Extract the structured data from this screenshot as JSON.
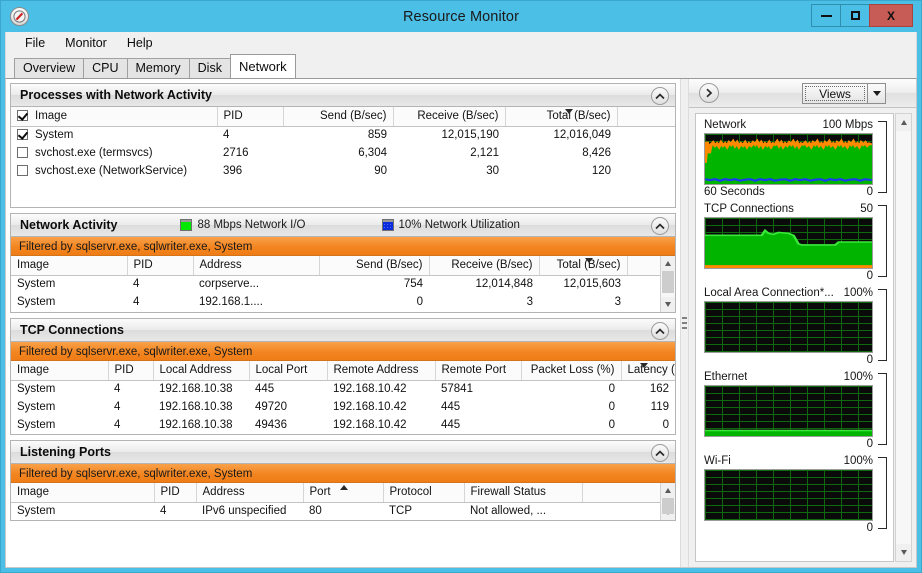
{
  "window": {
    "title": "Resource Monitor",
    "icon": "gauge-icon",
    "minimize_label": "–",
    "maximize_label": "□",
    "close_label": "X"
  },
  "menu": {
    "items": [
      "File",
      "Monitor",
      "Help"
    ]
  },
  "tabs": {
    "items": [
      "Overview",
      "CPU",
      "Memory",
      "Disk",
      "Network"
    ],
    "active": "Network"
  },
  "sections": {
    "processes": {
      "title": "Processes with Network Activity",
      "columns": [
        "Image",
        "PID",
        "Send (B/sec)",
        "Receive (B/sec)",
        "Total (B/sec)"
      ],
      "sort_column": "Total (B/sec)",
      "sort_dir": "desc",
      "rows": [
        {
          "checked": true,
          "image": "System",
          "pid": "4",
          "send": "859",
          "receive": "12,015,190",
          "total": "12,016,049"
        },
        {
          "checked": false,
          "image": "svchost.exe (termsvcs)",
          "pid": "2716",
          "send": "6,304",
          "receive": "2,121",
          "total": "8,426"
        },
        {
          "checked": false,
          "image": "svchost.exe (NetworkService)",
          "pid": "396",
          "send": "90",
          "receive": "30",
          "total": "120"
        }
      ]
    },
    "network_activity": {
      "title": "Network Activity",
      "legend": [
        {
          "color": "#00e800",
          "swatch": "green",
          "text": "88 Mbps Network I/O"
        },
        {
          "color": "#0a2bdb",
          "swatch": "blue",
          "text": "10% Network Utilization"
        }
      ],
      "filter": "Filtered by sqlservr.exe, sqlwriter.exe, System",
      "columns": [
        "Image",
        "PID",
        "Address",
        "Send (B/sec)",
        "Receive (B/sec)",
        "Total (B/sec)"
      ],
      "sort_column": "Total (B/sec)",
      "sort_dir": "desc",
      "rows": [
        {
          "image": "System",
          "pid": "4",
          "address": "corpserve...",
          "send": "754",
          "receive": "12,014,848",
          "total": "12,015,603"
        },
        {
          "image": "System",
          "pid": "4",
          "address": "192.168.1....",
          "send": "0",
          "receive": "3",
          "total": "3"
        }
      ]
    },
    "tcp_connections": {
      "title": "TCP Connections",
      "filter": "Filtered by sqlservr.exe, sqlwriter.exe, System",
      "columns": [
        "Image",
        "PID",
        "Local Address",
        "Local Port",
        "Remote Address",
        "Remote Port",
        "Packet Loss (%)",
        "Latency (ms)"
      ],
      "sort_column": "Latency (ms)",
      "sort_dir": "desc",
      "rows": [
        {
          "image": "System",
          "pid": "4",
          "local_address": "192.168.10.38",
          "local_port": "445",
          "remote_address": "192.168.10.42",
          "remote_port": "57841",
          "packet_loss": "0",
          "latency": "162"
        },
        {
          "image": "System",
          "pid": "4",
          "local_address": "192.168.10.38",
          "local_port": "49720",
          "remote_address": "192.168.10.42",
          "remote_port": "445",
          "packet_loss": "0",
          "latency": "119"
        },
        {
          "image": "System",
          "pid": "4",
          "local_address": "192.168.10.38",
          "local_port": "49436",
          "remote_address": "192.168.10.42",
          "remote_port": "445",
          "packet_loss": "0",
          "latency": "0"
        }
      ]
    },
    "listening_ports": {
      "title": "Listening Ports",
      "filter": "Filtered by sqlservr.exe, sqlwriter.exe, System",
      "columns": [
        "Image",
        "PID",
        "Address",
        "Port",
        "Protocol",
        "Firewall Status"
      ],
      "sort_column": "Port",
      "sort_dir": "asc",
      "rows": [
        {
          "image": "System",
          "pid": "4",
          "address": "IPv6 unspecified",
          "port": "80",
          "protocol": "TCP",
          "firewall": "Not allowed, ..."
        }
      ]
    }
  },
  "right_panel": {
    "expand_icon": "chevron-right-icon",
    "views_label": "Views",
    "views_dropdown_icon": "caret-down-icon",
    "graphs": [
      {
        "name": "Network",
        "scale_max": "100 Mbps",
        "scale_min": "0",
        "footer_left": "60 Seconds",
        "type": "network"
      },
      {
        "name": "TCP Connections",
        "scale_max": "50",
        "scale_min": "0",
        "footer_left": "",
        "type": "tcp"
      },
      {
        "name": "Local Area Connection*...",
        "scale_max": "100%",
        "scale_min": "0",
        "footer_left": "",
        "type": "empty"
      },
      {
        "name": "Ethernet",
        "scale_max": "100%",
        "scale_min": "0",
        "footer_left": "",
        "type": "ethernet"
      },
      {
        "name": "Wi-Fi",
        "scale_max": "100%",
        "scale_min": "0",
        "footer_left": "",
        "type": "empty"
      }
    ]
  },
  "chart_data": [
    {
      "type": "area",
      "title": "Network",
      "ylabel": "Mbps",
      "ylim": [
        0,
        100
      ],
      "xlabel": "60 Seconds",
      "grid": true,
      "series": [
        {
          "name": "Network I/O",
          "color": "#ff8a00",
          "values": [
            92,
            72,
            86,
            88,
            90,
            87,
            89,
            86,
            90,
            87,
            89,
            86,
            90,
            88,
            91,
            87,
            90,
            86,
            89,
            87,
            90,
            86,
            89,
            87,
            90,
            88,
            91,
            87,
            90,
            86,
            89,
            87,
            90,
            86,
            89,
            88,
            91,
            87,
            90,
            86,
            89,
            87,
            90,
            88,
            91,
            87,
            90,
            86,
            89,
            88
          ]
        },
        {
          "name": "Network Utilization",
          "color": "#1a3cf0",
          "values": [
            5,
            6,
            5,
            7,
            5,
            6,
            5,
            7,
            6,
            5,
            7,
            5,
            6,
            5,
            7,
            6,
            5,
            7,
            5,
            6,
            5,
            7,
            6,
            5,
            7,
            5,
            6,
            5,
            7,
            6,
            5,
            7,
            5,
            6,
            5,
            7,
            6,
            5,
            7,
            5,
            6,
            5,
            7,
            6,
            5,
            7,
            5,
            6,
            5,
            6
          ]
        }
      ]
    },
    {
      "type": "area",
      "title": "TCP Connections",
      "ylim": [
        0,
        50
      ],
      "grid": true,
      "series": [
        {
          "name": "Connections",
          "color": "#00c000",
          "values": [
            33,
            33,
            33,
            33,
            33,
            33,
            33,
            33,
            33,
            33,
            33,
            33,
            33,
            33,
            38,
            36,
            35,
            34,
            36,
            36,
            36,
            35,
            30,
            22,
            22,
            22,
            22,
            22,
            22,
            22,
            22,
            22,
            22,
            22,
            25,
            25,
            25,
            25,
            25,
            25
          ]
        }
      ]
    },
    {
      "type": "area",
      "title": "Local Area Connection*...",
      "ylim": [
        0,
        100
      ],
      "grid": true,
      "series": [
        {
          "name": "Utilization",
          "color": "#00c000",
          "values": [
            0,
            0,
            0,
            0,
            0,
            0,
            0,
            0,
            0,
            0,
            0,
            0,
            0,
            0,
            0,
            0,
            0,
            0,
            0,
            0
          ]
        }
      ]
    },
    {
      "type": "area",
      "title": "Ethernet",
      "ylim": [
        0,
        100
      ],
      "grid": true,
      "series": [
        {
          "name": "Utilization",
          "color": "#00c000",
          "values": [
            6,
            6,
            6,
            6,
            6,
            6,
            6,
            6,
            6,
            6,
            6,
            6,
            6,
            6,
            6,
            6,
            6,
            6,
            6,
            6
          ]
        }
      ]
    },
    {
      "type": "area",
      "title": "Wi-Fi",
      "ylim": [
        0,
        100
      ],
      "grid": true,
      "series": [
        {
          "name": "Utilization",
          "color": "#00c000",
          "values": [
            0,
            0,
            0,
            0,
            0,
            0,
            0,
            0,
            0,
            0,
            0,
            0,
            0,
            0,
            0,
            0,
            0,
            0,
            0,
            0
          ]
        }
      ]
    }
  ]
}
